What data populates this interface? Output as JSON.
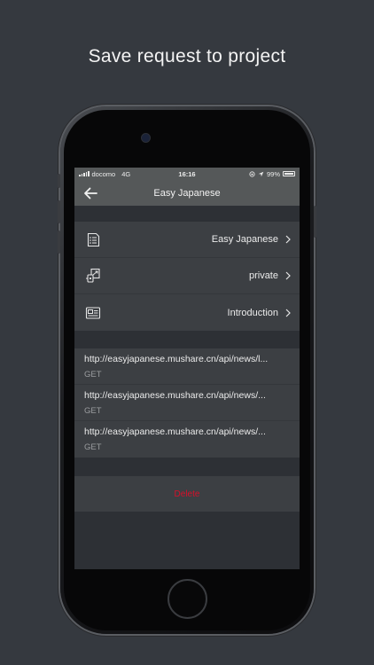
{
  "headline": "Save request to project",
  "status_bar": {
    "carrier": "docomo",
    "network": "4G",
    "time": "16:16",
    "battery": "99%",
    "battery_level": 0.99
  },
  "nav": {
    "back_icon": "arrow-left-icon",
    "title": "Easy Japanese"
  },
  "settings": [
    {
      "icon": "list-icon",
      "value": "Easy Japanese"
    },
    {
      "icon": "share-privacy-icon",
      "value": "private"
    },
    {
      "icon": "note-card-icon",
      "value": "Introduction"
    }
  ],
  "requests": [
    {
      "url": "http://easyjapanese.mushare.cn/api/news/l...",
      "method": "GET"
    },
    {
      "url": "http://easyjapanese.mushare.cn/api/news/...",
      "method": "GET"
    },
    {
      "url": "http://easyjapanese.mushare.cn/api/news/...",
      "method": "GET"
    }
  ],
  "delete_label": "Delete",
  "colors": {
    "background": "#35393f",
    "bar": "#555859",
    "cell": "#3c3f43",
    "danger": "#d6102a"
  }
}
